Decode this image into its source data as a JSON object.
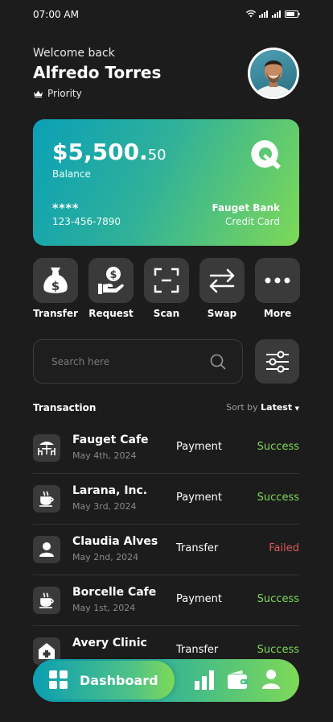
{
  "status_bar": {
    "time": "07:00 AM"
  },
  "header": {
    "greeting": "Welcome back",
    "user_name": "Alfredo Torres",
    "tier": "Priority",
    "avatar_icon": "profile-photo"
  },
  "card": {
    "balance_main": "$5,500.",
    "balance_cents": "50",
    "balance_label": "Balance",
    "masked": "****",
    "number": "123-456-7890",
    "bank_name": "Fauget Bank",
    "card_type": "Credit Card",
    "gradient": [
      "#0aa0b7",
      "#2fb19a",
      "#7ed957"
    ]
  },
  "actions": [
    {
      "label": "Transfer",
      "icon": "money-bag-icon"
    },
    {
      "label": "Request",
      "icon": "hand-coin-icon"
    },
    {
      "label": "Scan",
      "icon": "scan-icon"
    },
    {
      "label": "Swap",
      "icon": "swap-icon"
    },
    {
      "label": "More",
      "icon": "more-icon"
    }
  ],
  "search": {
    "placeholder": "Search here"
  },
  "transactions": {
    "title": "Transaction",
    "sort_prefix": "Sort by",
    "sort_value": "Latest",
    "items": [
      {
        "name": "Fauget Cafe",
        "date": "May 4th, 2024",
        "type": "Payment",
        "status": "Success",
        "icon": "cafe-table-icon"
      },
      {
        "name": "Larana, Inc.",
        "date": "May 3rd, 2024",
        "type": "Payment",
        "status": "Success",
        "icon": "coffee-cup-icon"
      },
      {
        "name": "Claudia Alves",
        "date": "May 2nd, 2024",
        "type": "Transfer",
        "status": "Failed",
        "icon": "person-icon"
      },
      {
        "name": "Borcelle Cafe",
        "date": "May 1st, 2024",
        "type": "Payment",
        "status": "Success",
        "icon": "coffee-cup-icon"
      },
      {
        "name": "Avery Clinic",
        "date": "",
        "type": "Transfer",
        "status": "Success",
        "icon": "clinic-icon"
      }
    ]
  },
  "bottom_nav": {
    "active_label": "Dashboard",
    "items": [
      "dashboard-icon",
      "chart-icon",
      "wallet-icon",
      "profile-icon"
    ]
  },
  "colors": {
    "success": "#7fd957",
    "failed": "#e05a5a",
    "tile": "#3a3a3a",
    "background": "#1c1c1c"
  }
}
